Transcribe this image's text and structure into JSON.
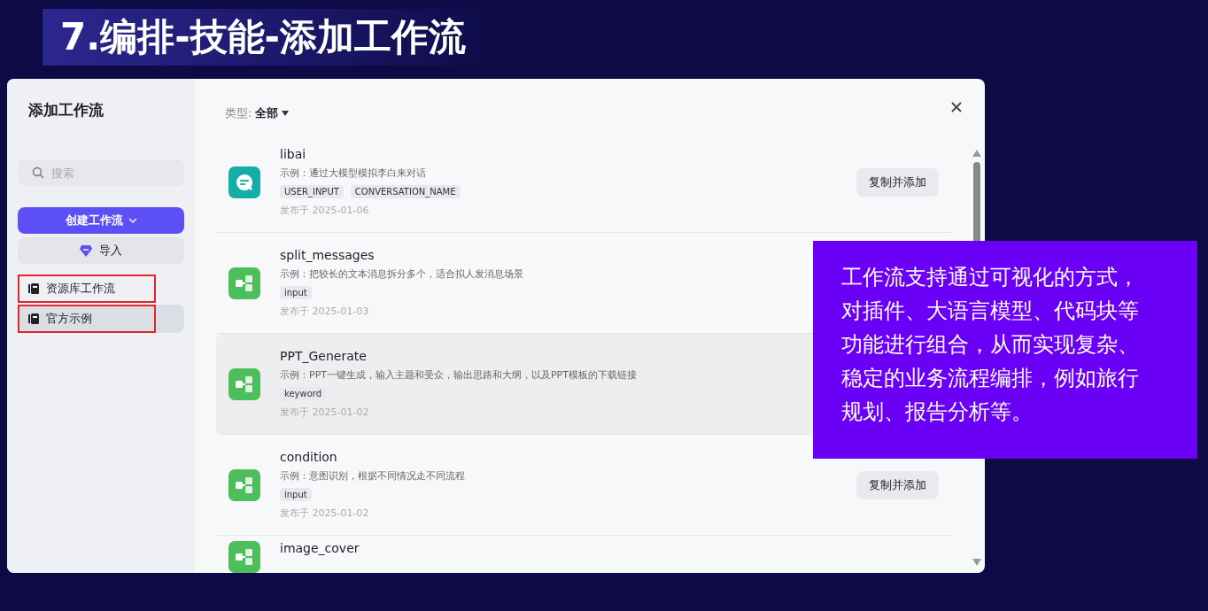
{
  "slide_title": "7.编排-技能-添加工作流",
  "dialog": {
    "title": "添加工作流",
    "search": {
      "placeholder": "搜索"
    },
    "create_button": "创建工作流",
    "import_button": "导入",
    "nav": [
      {
        "label": "资源库工作流",
        "selected": false,
        "outlined": true
      },
      {
        "label": "官方示例",
        "selected": true,
        "outlined": true
      }
    ],
    "filter": {
      "label": "类型:",
      "value": "全部"
    },
    "workflows": [
      {
        "name": "libai",
        "kind": "chat",
        "description": "示例：通过大模型模拟李白来对话",
        "tags": [
          "USER_INPUT",
          "CONVERSATION_NAME"
        ],
        "date": "发布于 2025-01-06",
        "action": "复制并添加",
        "highlighted": false
      },
      {
        "name": "split_messages",
        "kind": "workflow",
        "description": "示例：把较长的文本消息拆分多个，适合拟人发消息场景",
        "tags": [
          "input"
        ],
        "date": "发布于 2025-01-03",
        "highlighted": false
      },
      {
        "name": "PPT_Generate",
        "kind": "workflow",
        "description": "示例：PPT一键生成，输入主题和受众，输出思路和大纲，以及PPT模板的下载链接",
        "tags": [
          "keyword"
        ],
        "date": "发布于 2025-01-02",
        "highlighted": true
      },
      {
        "name": "condition",
        "kind": "workflow",
        "description": "示例：意图识别，根据不同情况走不同流程",
        "tags": [
          "input"
        ],
        "date": "发布于 2025-01-02",
        "action": "复制并添加",
        "highlighted": false
      },
      {
        "name": "image_cover",
        "kind": "workflow"
      }
    ]
  },
  "callout": "工作流支持通过可视化的方式，对插件、大语言模型、代码块等功能进行组合，从而实现复杂、稳定的业务流程编排，例如旅行规划、报告分析等。"
}
